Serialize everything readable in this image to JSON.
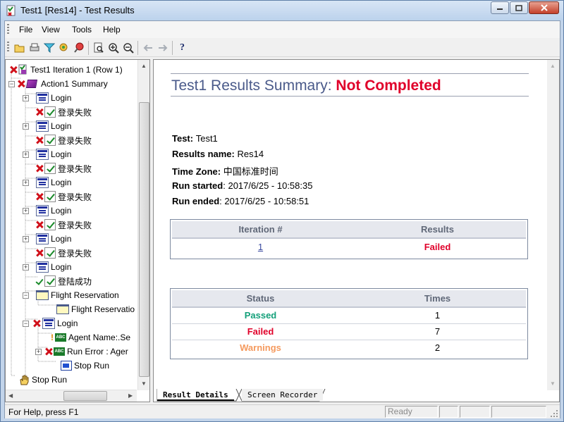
{
  "window": {
    "title": "Test1 [Res14] - Test Results"
  },
  "menu": {
    "file": "File",
    "view": "View",
    "tools": "Tools",
    "help": "Help"
  },
  "toolbar": {
    "buttons": [
      "open-icon",
      "print-icon",
      "filter-icon",
      "find-icon",
      "jump-to-step-icon",
      "preview-icon",
      "zoom-in-icon",
      "zoom-out-icon",
      "back-icon",
      "forward-icon",
      "help-icon"
    ]
  },
  "tree": {
    "items": [
      {
        "label": "Test1 Iteration 1 (Row 1)",
        "status": "failed"
      },
      {
        "label": "Action1 Summary",
        "status": "failed"
      },
      {
        "label": "Login"
      },
      {
        "label": "登录失败",
        "status": "failed"
      },
      {
        "label": "Login"
      },
      {
        "label": "登录失败",
        "status": "failed"
      },
      {
        "label": "Login"
      },
      {
        "label": "登录失败",
        "status": "failed"
      },
      {
        "label": "Login"
      },
      {
        "label": "登录失败",
        "status": "failed"
      },
      {
        "label": "Login"
      },
      {
        "label": "登录失败",
        "status": "failed"
      },
      {
        "label": "Login"
      },
      {
        "label": "登录失败",
        "status": "failed"
      },
      {
        "label": "Login"
      },
      {
        "label": "登陆成功",
        "status": "passed"
      },
      {
        "label": "Flight Reservation"
      },
      {
        "label": "Flight Reservatio"
      },
      {
        "label": "Login",
        "status": "failed"
      },
      {
        "label": "Agent Name:.Se",
        "status": "warning"
      },
      {
        "label": "Run Error : Ager",
        "status": "failed"
      },
      {
        "label": "Stop Run"
      },
      {
        "label": "Stop Run"
      }
    ]
  },
  "summary": {
    "title_prefix": "Test1 Results Summary: ",
    "title_status": "Not Completed",
    "test_label": "Test",
    "test_value": "Test1",
    "results_name_label": "Results name",
    "results_name_value": "Res14",
    "timezone_label": "Time Zone",
    "timezone_value": "中国标准时间",
    "run_started_label": "Run started",
    "run_started_value": "2017/6/25 - 10:58:35",
    "run_ended_label": "Run ended",
    "run_ended_value": "2017/6/25 - 10:58:51"
  },
  "iteration_table": {
    "headers": [
      "Iteration #",
      "Results"
    ],
    "rows": [
      {
        "iteration": "1",
        "result": "Failed"
      }
    ]
  },
  "status_table": {
    "headers": [
      "Status",
      "Times"
    ],
    "rows": [
      {
        "status": "Passed",
        "times": "1"
      },
      {
        "status": "Failed",
        "times": "7"
      },
      {
        "status": "Warnings",
        "times": "2"
      }
    ]
  },
  "tabs": {
    "result_details": "Result Details",
    "screen_recorder": "Screen Recorder"
  },
  "statusbar": {
    "help_text": "For Help, press F1",
    "ready": "Ready"
  },
  "colors": {
    "failed": "#e0002a",
    "passed": "#14a07a",
    "warning": "#f59a5e",
    "title": "#4a5a8a"
  }
}
